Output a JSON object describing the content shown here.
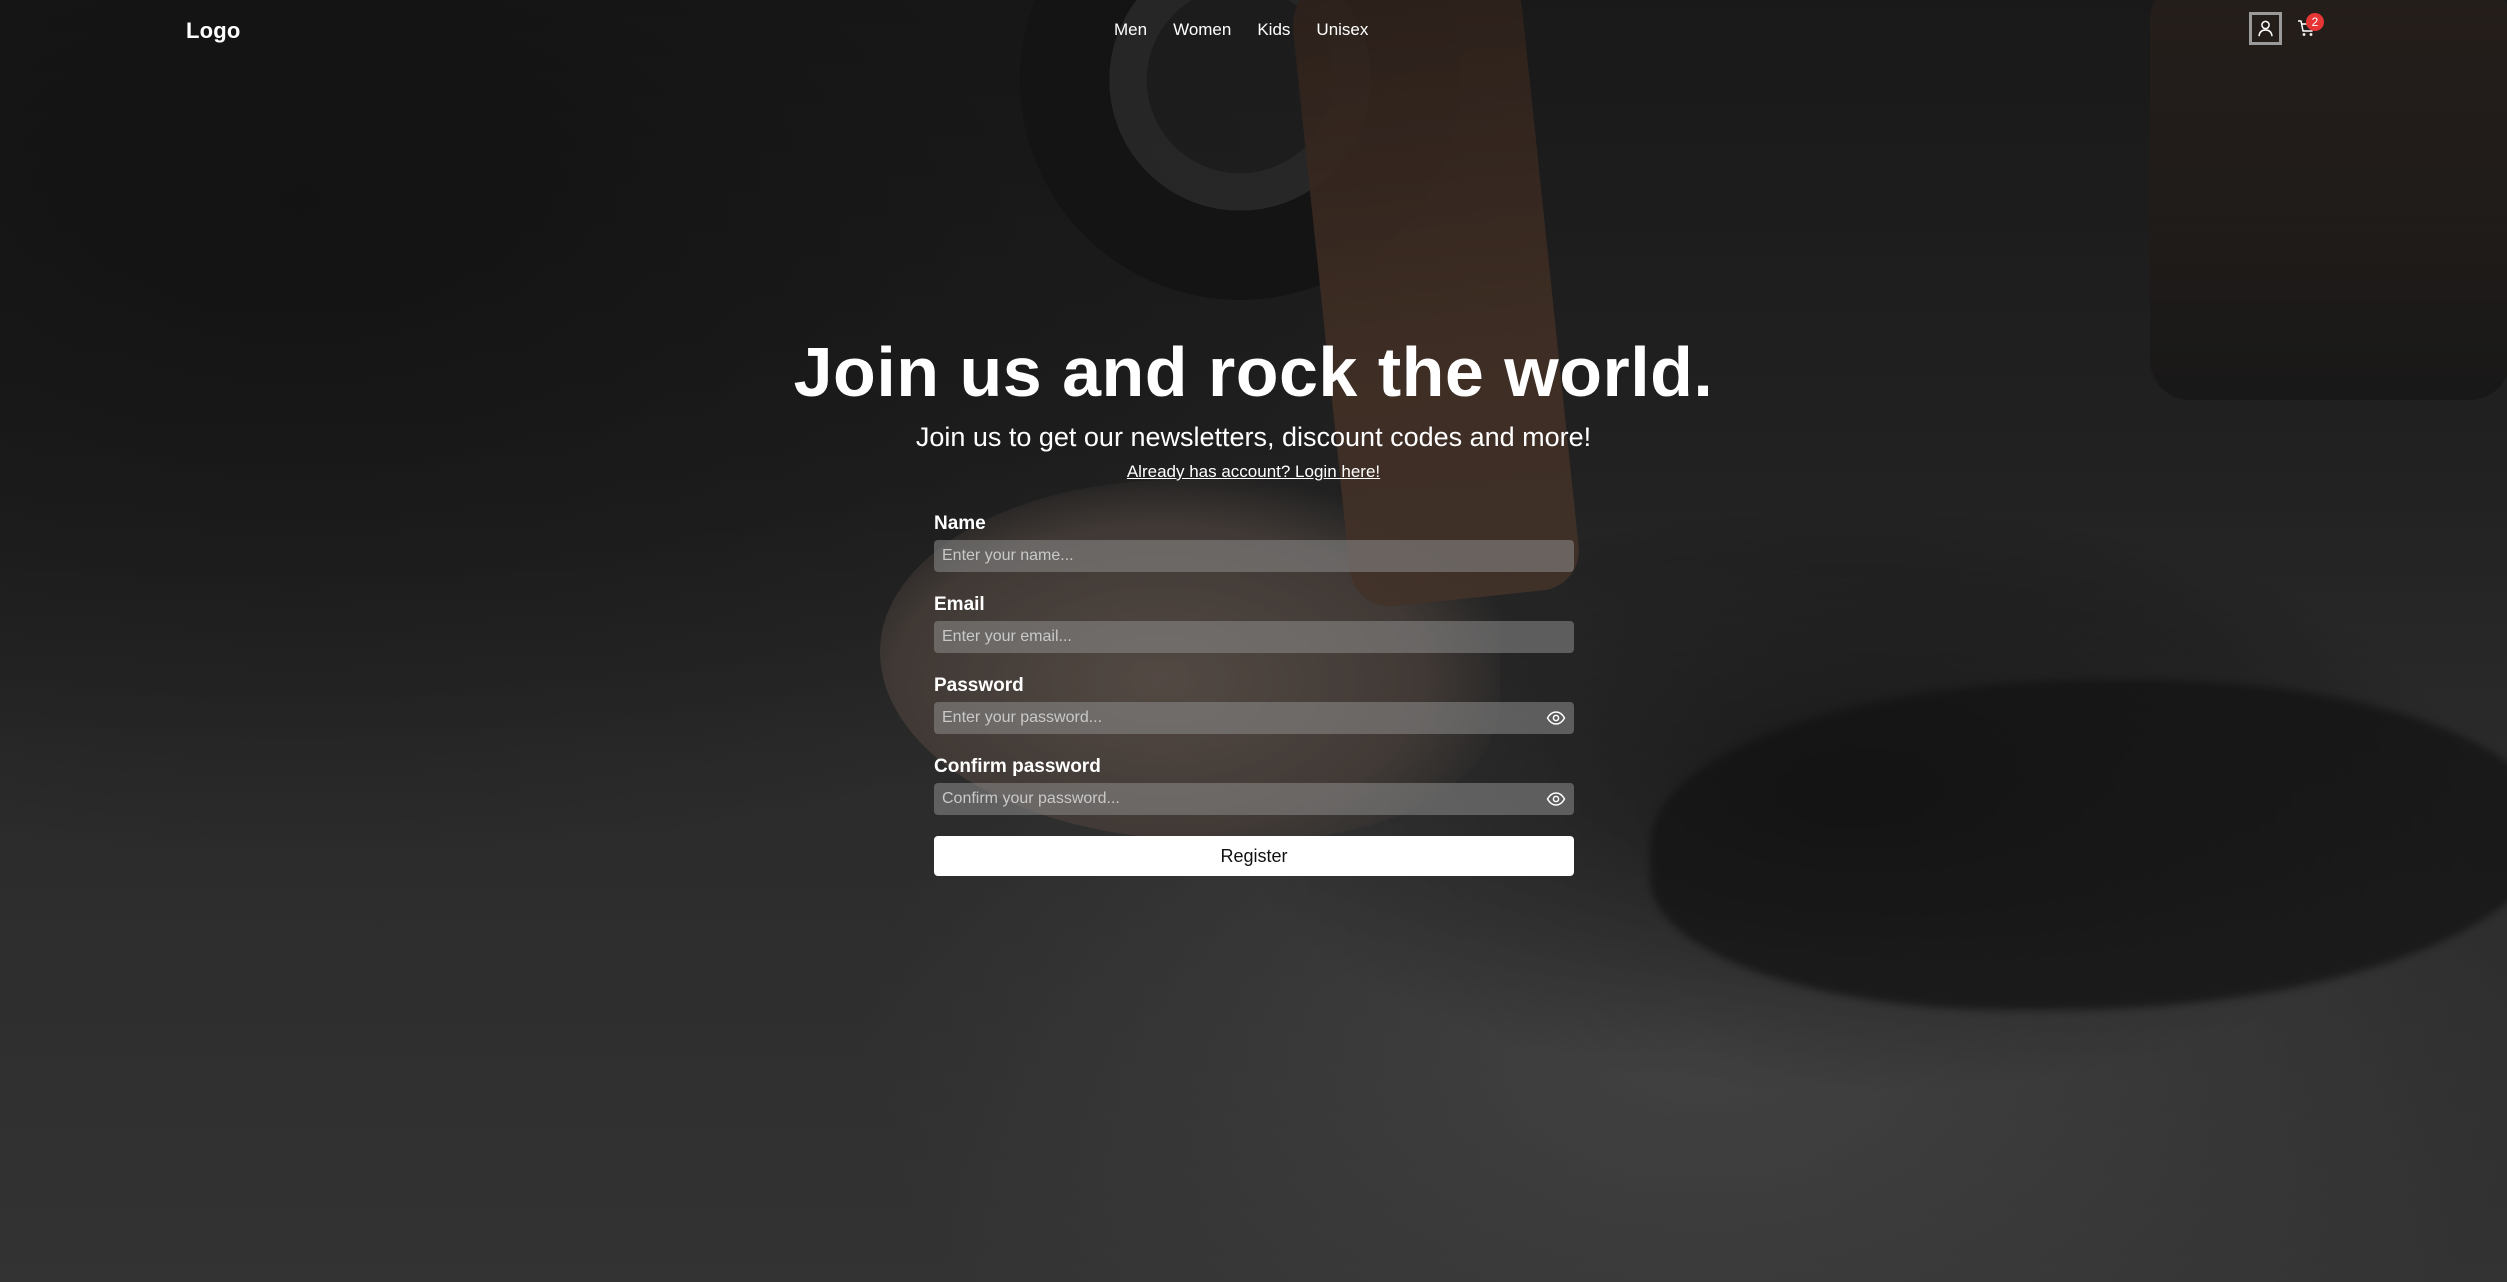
{
  "header": {
    "logo": "Logo",
    "nav": [
      "Men",
      "Women",
      "Kids",
      "Unisex"
    ],
    "cart_count": "2",
    "icons": {
      "user": "user-icon",
      "cart": "cart-icon"
    },
    "colors": {
      "badge": "#e53535"
    }
  },
  "hero": {
    "title": "Join us and rock the world.",
    "subtitle": "Join us to get our newsletters, discount codes and more!",
    "login_link": "Already has account? Login here!"
  },
  "form": {
    "name": {
      "label": "Name",
      "placeholder": "Enter your name..."
    },
    "email": {
      "label": "Email",
      "placeholder": "Enter your email..."
    },
    "password": {
      "label": "Password",
      "placeholder": "Enter your password..."
    },
    "confirm_password": {
      "label": "Confirm password",
      "placeholder": "Confirm your password..."
    },
    "submit_label": "Register",
    "icons": {
      "toggle_visibility": "eye-icon"
    }
  }
}
